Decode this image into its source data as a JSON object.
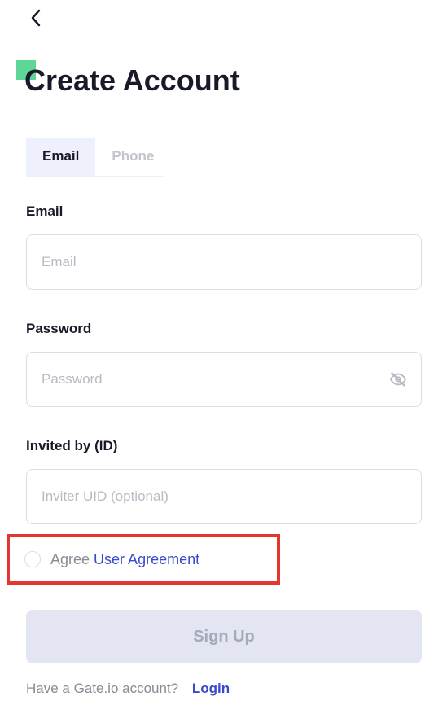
{
  "header": {
    "title": "Create Account"
  },
  "tabs": {
    "email": "Email",
    "phone": "Phone"
  },
  "form": {
    "email": {
      "label": "Email",
      "placeholder": "Email",
      "value": ""
    },
    "password": {
      "label": "Password",
      "placeholder": "Password",
      "value": ""
    },
    "invited": {
      "label": "Invited by (ID)",
      "placeholder": "Inviter UID (optional)",
      "value": ""
    }
  },
  "agreement": {
    "agree_text": "Agree ",
    "link_text": "User Agreement",
    "checked": false
  },
  "signup_button": "Sign Up",
  "footer": {
    "prompt": "Have a Gate.io account?",
    "login": "Login"
  },
  "colors": {
    "accent_green": "#5fd695",
    "highlight_red": "#e8342f",
    "link_blue": "#3a4acb",
    "button_disabled_bg": "#e3e5f2"
  }
}
